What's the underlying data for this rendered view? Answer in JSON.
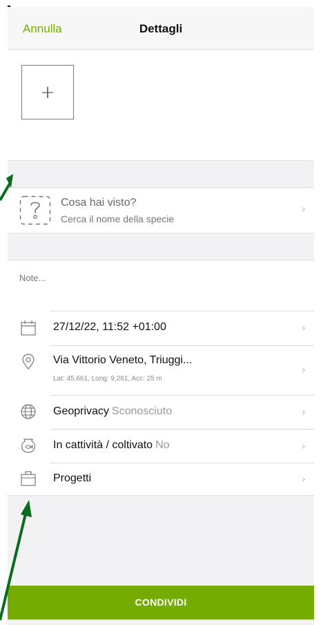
{
  "header": {
    "cancel_label": "Annulla",
    "title": "Dettagli"
  },
  "photo": {
    "add_symbol": "+"
  },
  "species": {
    "title": "Cosa hai visto?",
    "subtitle": "Cerca il nome della specie",
    "icon": "unknown-species-icon"
  },
  "notes": {
    "placeholder": "Note..."
  },
  "rows": {
    "date": {
      "label": "27/12/22, 11:52 +01:00",
      "icon": "calendar-icon"
    },
    "location": {
      "label": "Via Vittorio Veneto, Triuggi...",
      "coords": "Lat: 45,661, Long: 9,261, Acc: 25 m",
      "icon": "location-pin-icon"
    },
    "geoprivacy": {
      "label": "Geoprivacy",
      "value": "Sconosciuto",
      "icon": "globe-icon"
    },
    "captive": {
      "label": "In cattività / coltivato",
      "value": "No",
      "icon": "fishbowl-icon"
    },
    "projects": {
      "label": "Progetti",
      "icon": "briefcase-icon"
    }
  },
  "chevron": "›",
  "share_button_label": "CONDIVIDI",
  "colors": {
    "accent": "#74ac00",
    "annotation_arrow": "#0b6b1f"
  }
}
